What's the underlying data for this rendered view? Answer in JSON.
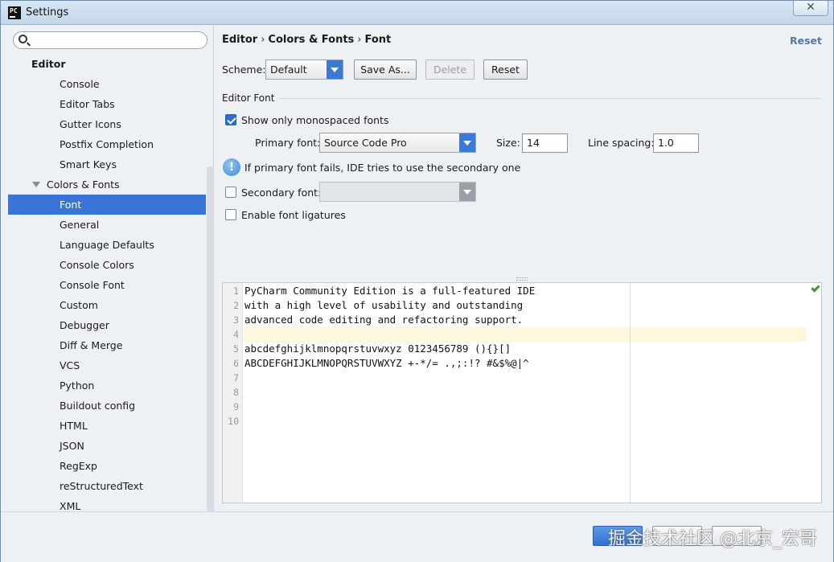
{
  "window": {
    "title": "Settings",
    "close_glyph": "✕"
  },
  "sidebar": {
    "search_placeholder": "",
    "group": "Editor",
    "items": [
      {
        "label": "Console"
      },
      {
        "label": "Editor Tabs"
      },
      {
        "label": "Gutter Icons"
      },
      {
        "label": "Postfix Completion"
      },
      {
        "label": "Smart Keys"
      }
    ],
    "subgroup": "Colors & Fonts",
    "subitems": [
      {
        "label": "Font",
        "selected": true
      },
      {
        "label": "General"
      },
      {
        "label": "Language Defaults"
      },
      {
        "label": "Console Colors"
      },
      {
        "label": "Console Font"
      },
      {
        "label": "Custom"
      },
      {
        "label": "Debugger"
      },
      {
        "label": "Diff & Merge"
      },
      {
        "label": "VCS"
      },
      {
        "label": "Python"
      },
      {
        "label": "Buildout config"
      },
      {
        "label": "HTML"
      },
      {
        "label": "JSON"
      },
      {
        "label": "RegExp"
      },
      {
        "label": "reStructuredText"
      },
      {
        "label": "XML"
      }
    ]
  },
  "main": {
    "breadcrumb": [
      "Editor",
      "Colors & Fonts",
      "Font"
    ],
    "reset_link": "Reset",
    "scheme_label": "Scheme:",
    "scheme_value": "Default",
    "save_as": "Save As...",
    "delete": "Delete",
    "reset": "Reset",
    "section_title": "Editor Font",
    "mono_only_label": "Show only monospaced fonts",
    "mono_only_checked": true,
    "primary_font_label": "Primary font:",
    "primary_font_value": "Source Code Pro",
    "size_label": "Size:",
    "size_value": "14",
    "line_spacing_label": "Line spacing:",
    "line_spacing_value": "1.0",
    "info_text": "If primary font fails, IDE tries to use the secondary one",
    "secondary_font_label": "Secondary font:",
    "secondary_checked": false,
    "ligatures_label": "Enable font ligatures",
    "ligatures_checked": false
  },
  "preview": {
    "line_numbers": [
      "1",
      "2",
      "3",
      "4",
      "5",
      "6",
      "7",
      "8",
      "9",
      "10"
    ],
    "lines": [
      "PyCharm Community Edition is a full-featured IDE",
      "with a high level of usability and outstanding",
      "advanced code editing and refactoring support.",
      "",
      "abcdefghijklmnopqrstuvwxyz 0123456789 (){}[]",
      "ABCDEFGHIJKLMNOPQRSTUVWXYZ +-*/= .,;:!? #&$%@|^",
      "",
      "",
      "",
      ""
    ]
  },
  "footer": {
    "watermark": "掘金技术社区 @北京_宏哥"
  },
  "colors": {
    "selection": "#3875d7",
    "accent": "#3a7ad6",
    "link": "#5877a6"
  }
}
